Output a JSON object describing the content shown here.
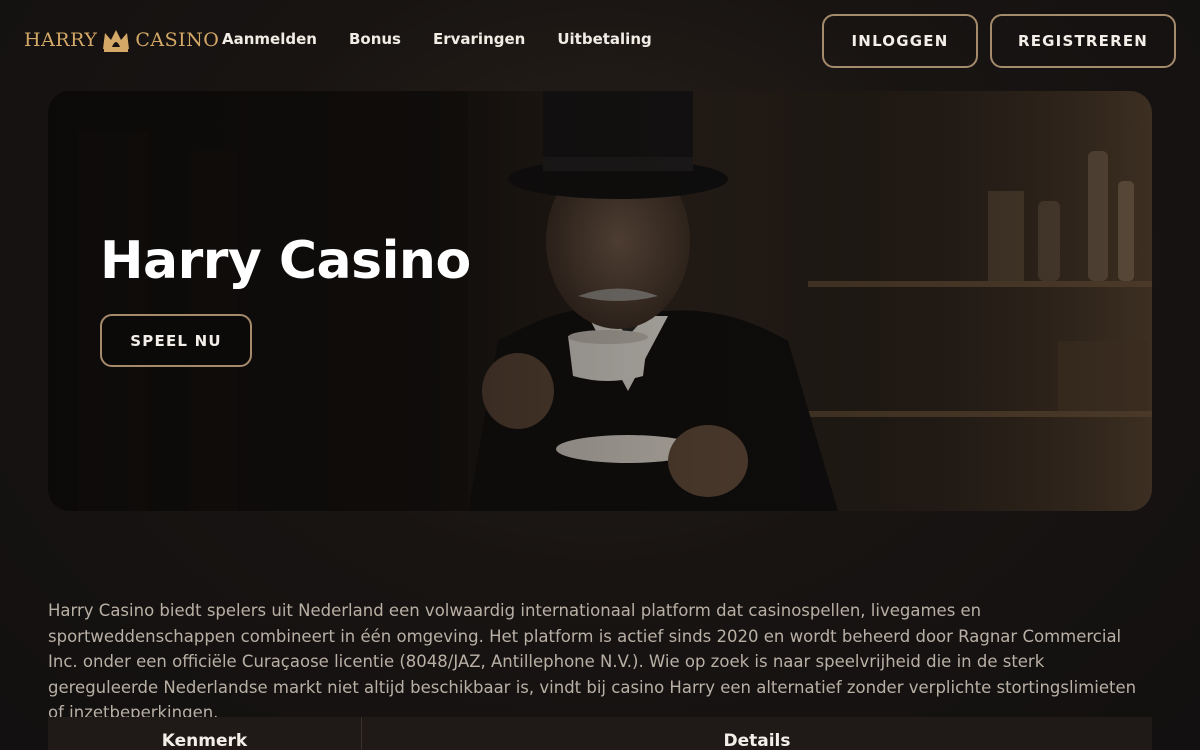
{
  "header": {
    "logo_text_left": "HARRY",
    "logo_text_right": "CASINO",
    "nav": [
      "Aanmelden",
      "Bonus",
      "Ervaringen",
      "Uitbetaling"
    ],
    "login_label": "INLOGGEN",
    "register_label": "REGISTREREN"
  },
  "hero": {
    "title": "Harry Casino",
    "cta_label": "SPEEL NU"
  },
  "intro": {
    "text": "Harry Casino biedt spelers uit Nederland een volwaardig internationaal platform dat casinospellen, livegames en sportweddenschappen combineert in één omgeving. Het platform is actief sinds 2020 en wordt beheerd door Ragnar Commercial Inc. onder een officiële Curaçaose licentie (8048/JAZ, Antillephone N.V.). Wie op zoek is naar speelvrijheid die in de sterk gereguleerde Nederlandse markt niet altijd beschikbaar is, vindt bij casino Harry een alternatief zonder verplichte stortingslimieten of inzetbeperkingen."
  },
  "table": {
    "headers": [
      "Kenmerk",
      "Details"
    ]
  },
  "colors": {
    "accent_gold": "#d4a866",
    "border_tan": "#a58a6c",
    "background": "#141110"
  },
  "icons": {
    "logo_crown": "crown-icon"
  }
}
